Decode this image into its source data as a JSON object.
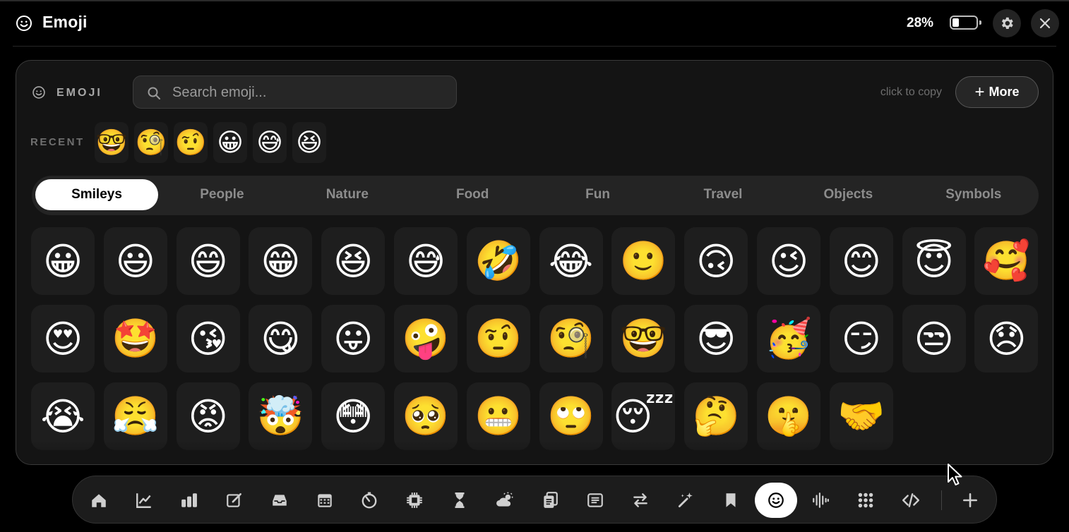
{
  "window": {
    "title": "Emoji",
    "battery_percent_label": "28%",
    "battery_fraction": 0.28
  },
  "panel": {
    "header_label": "EMOJI",
    "search_placeholder": "Search emoji...",
    "copy_hint": "click to copy",
    "more_label": "More",
    "recent_label": "RECENT",
    "recent": [
      "🤓",
      "🧐",
      "🤨",
      "😀",
      "😅",
      "😆"
    ]
  },
  "categories": [
    {
      "label": "Smileys",
      "active": true
    },
    {
      "label": "People",
      "active": false
    },
    {
      "label": "Nature",
      "active": false
    },
    {
      "label": "Food",
      "active": false
    },
    {
      "label": "Fun",
      "active": false
    },
    {
      "label": "Travel",
      "active": false
    },
    {
      "label": "Objects",
      "active": false
    },
    {
      "label": "Symbols",
      "active": false
    }
  ],
  "emoji_grid": [
    "😀",
    "😃",
    "😄",
    "😁",
    "😆",
    "😅",
    "🤣",
    "😂",
    "🙂",
    "🙃",
    "😉",
    "😊",
    "😇",
    "🥰",
    "😍",
    "🤩",
    "😘",
    "😋",
    "😛",
    "🤪",
    "🤨",
    "🧐",
    "🤓",
    "😎",
    "🥳",
    "😏",
    "😒",
    "😞",
    "😭",
    "😤",
    "😡",
    "🤯",
    "😳",
    "🥺",
    "😬",
    "🙄",
    "😴",
    "🤔",
    "🤫",
    "🤝"
  ],
  "dock": {
    "items": [
      {
        "icon": "home-icon"
      },
      {
        "icon": "line-chart-icon"
      },
      {
        "icon": "bar-chart-icon"
      },
      {
        "icon": "edit-icon"
      },
      {
        "icon": "inbox-icon"
      },
      {
        "icon": "calendar-icon"
      },
      {
        "icon": "timer-icon"
      },
      {
        "icon": "chip-icon"
      },
      {
        "icon": "hourglass-icon"
      },
      {
        "icon": "weather-icon"
      },
      {
        "icon": "clipboard-icon"
      },
      {
        "icon": "news-icon"
      },
      {
        "icon": "convert-icon"
      },
      {
        "icon": "magic-wand-icon"
      },
      {
        "icon": "bookmark-icon"
      },
      {
        "icon": "emoji-icon",
        "active": true
      },
      {
        "icon": "audio-wave-icon"
      },
      {
        "icon": "apps-grid-icon"
      },
      {
        "icon": "code-icon"
      }
    ],
    "add_icon": "plus-icon"
  },
  "colors": {
    "background": "#000000",
    "panel": "#141414",
    "cell": "#1e1e1e",
    "active_pill": "#ffffff",
    "muted_text": "#8c8c8c"
  }
}
